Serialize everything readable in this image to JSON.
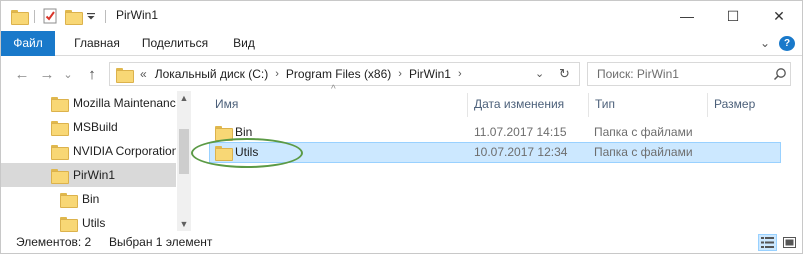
{
  "window": {
    "title": "PirWin1",
    "minimize_glyph": "—",
    "maximize_glyph": "☐",
    "close_glyph": "✕"
  },
  "quick_access": {
    "icons": [
      "folder-icon",
      "properties-icon",
      "new-folder-icon",
      "customize-dropdown-icon"
    ]
  },
  "ribbon": {
    "tabs": [
      {
        "label": "Файл",
        "active": true
      },
      {
        "label": "Главная"
      },
      {
        "label": "Поделиться"
      },
      {
        "label": "Вид"
      }
    ],
    "expand_glyph": "⌄",
    "help_glyph": "?"
  },
  "navigation": {
    "back_glyph": "←",
    "forward_glyph": "→",
    "recent_glyph": "⌄",
    "up_glyph": "↑",
    "address": {
      "overflow": "«",
      "crumbs": [
        "Локальный диск (C:)",
        "Program Files (x86)",
        "PirWin1"
      ],
      "dropdown_glyph": "⌄",
      "refresh_glyph": "↻"
    },
    "search": {
      "placeholder": "Поиск: PirWin1"
    }
  },
  "nav_pane": {
    "items": [
      {
        "label": "Mozilla Maintenanc",
        "indent": 1
      },
      {
        "label": "MSBuild",
        "indent": 1
      },
      {
        "label": "NVIDIA Corporation",
        "indent": 1
      },
      {
        "label": "PirWin1",
        "indent": 1,
        "selected": true
      },
      {
        "label": "Bin",
        "indent": 2
      },
      {
        "label": "Utils",
        "indent": 2
      }
    ],
    "scroll_up_glyph": "▲",
    "scroll_down_glyph": "▼"
  },
  "file_list": {
    "columns": [
      "Имя",
      "Дата изменения",
      "Тип",
      "Размер"
    ],
    "sort_glyph": "^",
    "rows": [
      {
        "name": "Bin",
        "date": "11.07.2017 14:15",
        "type": "Папка с файлами",
        "size": ""
      },
      {
        "name": "Utils",
        "date": "10.07.2017 12:34",
        "type": "Папка с файлами",
        "size": "",
        "selected": true
      }
    ]
  },
  "status_bar": {
    "items_count": "Элементов: 2",
    "selection": "Выбран 1 элемент"
  },
  "colors": {
    "accent": "#1979ca",
    "selection_bg": "#cce8ff",
    "selection_border": "#99d1ff",
    "annotation": "#5b9a45"
  }
}
